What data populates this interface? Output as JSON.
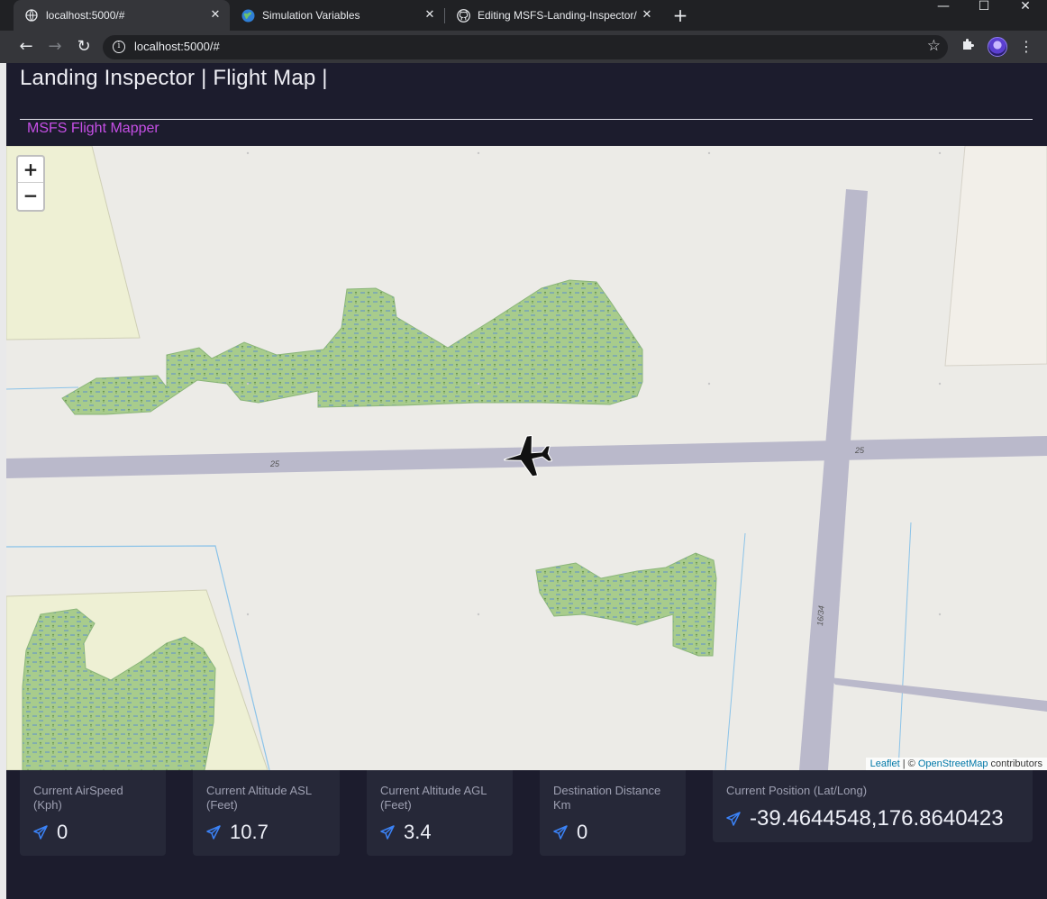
{
  "browser": {
    "tabs": [
      {
        "title": "localhost:5000/#",
        "active": true
      },
      {
        "title": "Simulation Variables",
        "active": false
      },
      {
        "title": "Editing MSFS-Landing-Inspector/",
        "active": false
      }
    ],
    "url": "localhost:5000/#"
  },
  "app": {
    "title": "Landing Inspector | Flight Map |",
    "subtitle": "MSFS Flight Mapper",
    "accent_color": "#c64fe6"
  },
  "map": {
    "zoom_in": "+",
    "zoom_out": "−",
    "runway_labels": [
      "25",
      "25",
      "16/34"
    ],
    "attribution": {
      "leaflet": "Leaflet",
      "separator": " | © ",
      "osm": "OpenStreetMap",
      "suffix": " contributors"
    }
  },
  "stats": [
    {
      "label": "Current AirSpeed (Kph)",
      "value": "0"
    },
    {
      "label": "Current Altitude ASL (Feet)",
      "value": "10.7"
    },
    {
      "label": "Current Altitude AGL (Feet)",
      "value": "3.4"
    },
    {
      "label": "Destination Distance Km",
      "value": "0"
    },
    {
      "label": "Current Position (Lat/Long)",
      "value": "-39.4644548,176.8640423"
    }
  ]
}
